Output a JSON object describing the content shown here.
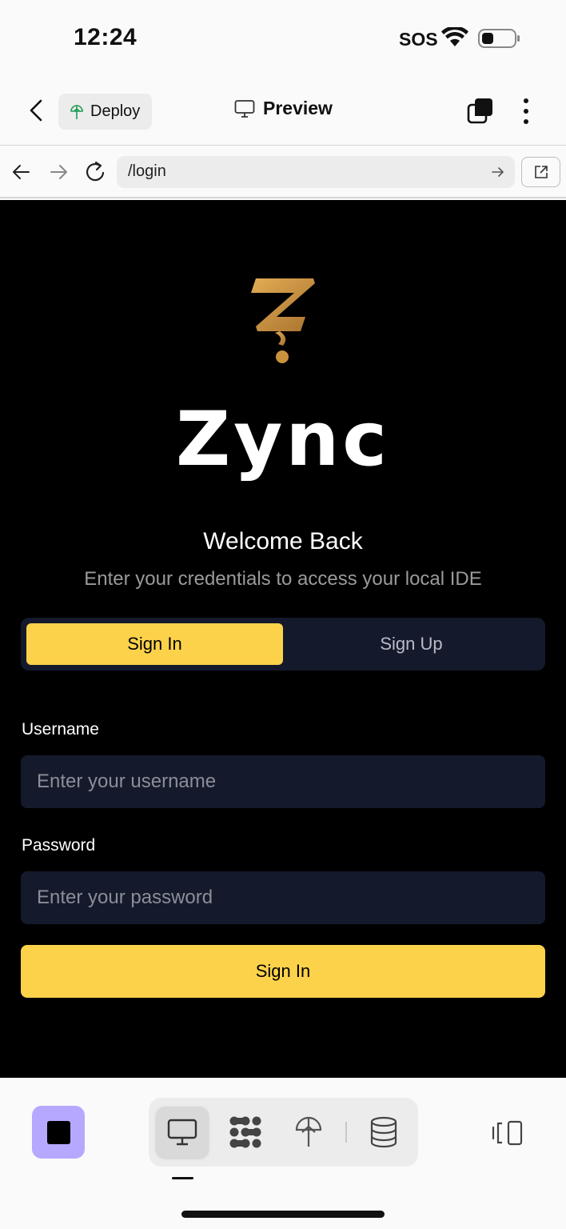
{
  "status_bar": {
    "time": "12:24",
    "sos": "SOS"
  },
  "header": {
    "deploy_label": "Deploy",
    "preview_label": "Preview"
  },
  "browser": {
    "url": "/login"
  },
  "login": {
    "brand": "Zync",
    "welcome": "Welcome Back",
    "subtitle": "Enter your credentials to access your local IDE",
    "tabs": [
      {
        "label": "Sign In",
        "active": true
      },
      {
        "label": "Sign Up",
        "active": false
      }
    ],
    "username_label": "Username",
    "username_placeholder": "Enter your username",
    "password_label": "Password",
    "password_placeholder": "Enter your password",
    "submit_label": "Sign In"
  },
  "toolbar": {
    "icons": [
      "stop-icon",
      "monitor-icon",
      "dots-grid-icon",
      "deploy-icon",
      "database-icon",
      "panel-toggle-icon"
    ]
  },
  "colors": {
    "accent_yellow": "#fdd24b",
    "stop_purple": "#b7a8ff",
    "field_bg": "#141a2b",
    "logo_gold": "#c9933d"
  }
}
